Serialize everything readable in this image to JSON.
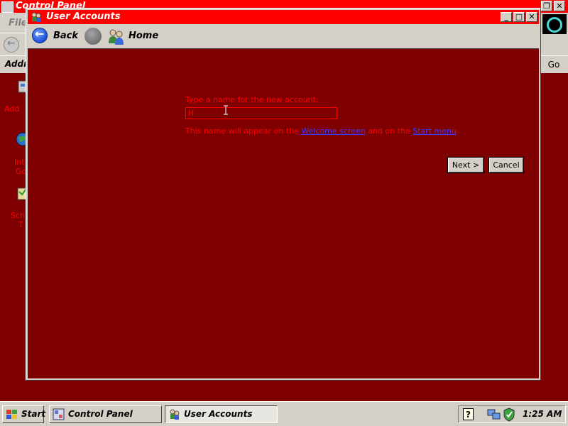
{
  "background_window": {
    "title": "Control Panel",
    "menu_file": "File",
    "address_label": "Addr",
    "go_label": "Go",
    "desktop_labels": [
      "Add",
      "Int",
      "Go",
      "Sch",
      "T"
    ]
  },
  "dialog": {
    "title": "User Accounts",
    "nav": {
      "back_label": "Back",
      "home_label": "Home"
    },
    "prompt": "Type a name for the new account:",
    "input_value": "H",
    "info_prefix": "This name will appear on the ",
    "info_link1": "Welcome screen",
    "info_middle": " and on the ",
    "info_link2": "Start menu",
    "info_suffix": ".",
    "buttons": {
      "next": "Next >",
      "cancel": "Cancel"
    }
  },
  "taskbar": {
    "start_label": "Start",
    "items": [
      {
        "label": "Control Panel",
        "active": false
      },
      {
        "label": "User Accounts",
        "active": true
      }
    ],
    "help_glyph": "?",
    "clock": "1:25 AM"
  },
  "colors": {
    "window_bg": "#7e0000",
    "titlebar": "#ff0000",
    "text_accent": "#ff0000",
    "link": "#3b3bff",
    "chrome": "#d4d0c8"
  },
  "icons": {
    "back": "back-arrow-icon",
    "forward": "forward-arrow-icon",
    "home": "users-home-icon",
    "start": "windows-flag-icon",
    "tray_help": "help-icon",
    "tray_network": "network-icon",
    "tray_security": "security-shield-icon"
  }
}
